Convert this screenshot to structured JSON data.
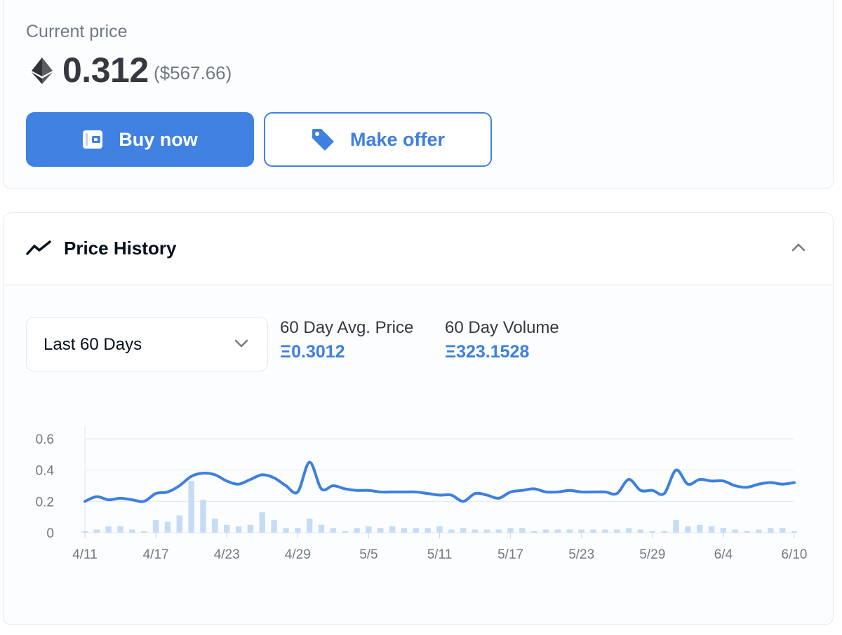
{
  "price": {
    "label": "Current price",
    "value": "0.312",
    "usd": "($567.66)",
    "icon": "eth-icon"
  },
  "buttons": {
    "buy_label": "Buy now",
    "offer_label": "Make offer",
    "accent": "#4081e1"
  },
  "history": {
    "title": "Price History",
    "range_selected": "Last 60 Days",
    "avg_label": "60 Day Avg. Price",
    "avg_value": "Ξ0.3012",
    "volume_label": "60 Day Volume",
    "volume_value": "Ξ323.1528"
  },
  "chart_data": {
    "type": "line",
    "ylim": [
      0,
      0.6
    ],
    "yticks": [
      "0",
      "0.2",
      "0.4",
      "0.6"
    ],
    "xtick_labels": [
      "4/11",
      "4/17",
      "4/23",
      "4/29",
      "5/5",
      "5/11",
      "5/17",
      "5/23",
      "5/29",
      "6/4",
      "6/10"
    ],
    "x": [
      "4/11",
      "4/12",
      "4/13",
      "4/14",
      "4/15",
      "4/16",
      "4/17",
      "4/18",
      "4/19",
      "4/20",
      "4/21",
      "4/22",
      "4/23",
      "4/24",
      "4/25",
      "4/26",
      "4/27",
      "4/28",
      "4/29",
      "4/30",
      "5/1",
      "5/2",
      "5/3",
      "5/4",
      "5/5",
      "5/6",
      "5/7",
      "5/8",
      "5/9",
      "5/10",
      "5/11",
      "5/12",
      "5/13",
      "5/14",
      "5/15",
      "5/16",
      "5/17",
      "5/18",
      "5/19",
      "5/20",
      "5/21",
      "5/22",
      "5/23",
      "5/24",
      "5/25",
      "5/26",
      "5/27",
      "5/28",
      "5/29",
      "5/30",
      "5/31",
      "6/1",
      "6/2",
      "6/3",
      "6/4",
      "6/5",
      "6/6",
      "6/7",
      "6/8",
      "6/9",
      "6/10"
    ],
    "series": [
      {
        "type": "line",
        "color": "#3e7fe0",
        "values": [
          0.2,
          0.23,
          0.21,
          0.22,
          0.21,
          0.2,
          0.25,
          0.26,
          0.3,
          0.36,
          0.38,
          0.37,
          0.33,
          0.31,
          0.34,
          0.37,
          0.35,
          0.3,
          0.26,
          0.45,
          0.28,
          0.3,
          0.28,
          0.27,
          0.27,
          0.26,
          0.26,
          0.26,
          0.26,
          0.25,
          0.24,
          0.24,
          0.2,
          0.25,
          0.24,
          0.22,
          0.26,
          0.27,
          0.28,
          0.26,
          0.26,
          0.27,
          0.26,
          0.26,
          0.26,
          0.25,
          0.34,
          0.27,
          0.27,
          0.25,
          0.4,
          0.31,
          0.34,
          0.33,
          0.33,
          0.3,
          0.29,
          0.31,
          0.32,
          0.31,
          0.32
        ]
      },
      {
        "type": "bar",
        "color": "#c5dcf5",
        "values": [
          0.01,
          0.02,
          0.04,
          0.04,
          0.02,
          0.01,
          0.08,
          0.07,
          0.11,
          0.33,
          0.21,
          0.09,
          0.05,
          0.04,
          0.05,
          0.13,
          0.08,
          0.03,
          0.03,
          0.09,
          0.05,
          0.03,
          0.01,
          0.03,
          0.04,
          0.03,
          0.04,
          0.03,
          0.03,
          0.03,
          0.04,
          0.02,
          0.03,
          0.02,
          0.02,
          0.02,
          0.03,
          0.03,
          0.01,
          0.02,
          0.02,
          0.02,
          0.02,
          0.02,
          0.02,
          0.02,
          0.03,
          0.02,
          0.01,
          0.01,
          0.08,
          0.04,
          0.05,
          0.04,
          0.03,
          0.02,
          0.01,
          0.02,
          0.03,
          0.03,
          0.01
        ]
      }
    ]
  }
}
